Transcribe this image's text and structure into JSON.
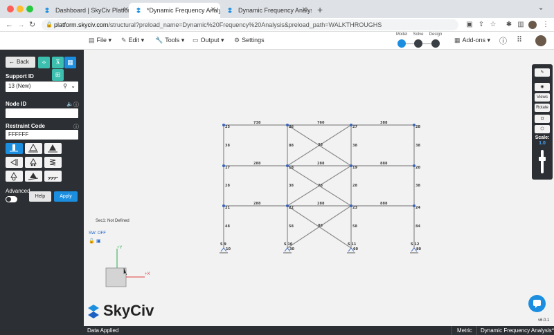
{
  "browser": {
    "tabs": [
      {
        "title": "Dashboard | SkyCiv Platform",
        "active": false
      },
      {
        "title": "*Dynamic Frequency Analysis |",
        "active": true
      },
      {
        "title": "Dynamic Frequency Analysis |",
        "active": false
      }
    ],
    "url_host": "platform.skyciv.com",
    "url_path": "/structural?preload_name=Dynamic%20Frequency%20Analysis&preload_path=WALKTHROUGHS"
  },
  "toolbar": {
    "file": "File",
    "edit": "Edit",
    "tools": "Tools",
    "output": "Output",
    "settings": "Settings",
    "steps": [
      "Model",
      "Solve",
      "Design"
    ],
    "addons": "Add-ons"
  },
  "panel": {
    "back": "Back",
    "support_id_label": "Support ID",
    "support_id_value": "13 (New)",
    "node_id_label": "Node ID",
    "node_id_value": "",
    "restraint_code_label": "Restraint Code",
    "restraint_code_value": "FFFFFF",
    "advanced_label": "Advanced",
    "help": "Help",
    "apply": "Apply"
  },
  "canvas": {
    "section_note": "Sec1: Not Defined",
    "sw_status": "SW: OFF",
    "axis_y": "+Y",
    "axis_x": "+X",
    "logo_text": "SkyCiv",
    "version": "v6.0.1",
    "node_labels": [
      "25",
      "26",
      "27",
      "28",
      "17",
      "18",
      "19",
      "20",
      "21",
      "22",
      "23",
      "24",
      "1",
      "2",
      "3",
      "4",
      "5",
      "6",
      "7",
      "8"
    ],
    "member_labels_top": [
      "738",
      "760",
      "388",
      "386"
    ],
    "member_labels_mid": [
      "288",
      "288",
      "888"
    ],
    "member_labels_low": [
      "288",
      "288",
      "888"
    ],
    "support_labels": [
      "S 9",
      "S 10",
      "S 11",
      "S 12"
    ]
  },
  "right_toolbar": {
    "views": "Views",
    "rotate": "Rotate",
    "scale_label": "Scale:",
    "scale_value": "1.0"
  },
  "status": {
    "left": "Data Applied",
    "units": "Metric",
    "model_name": "Dynamic Frequency Analysis*"
  },
  "colors": {
    "accent": "#1b8ee0",
    "panel": "#2c2f33",
    "teal": "#3cbfae"
  }
}
